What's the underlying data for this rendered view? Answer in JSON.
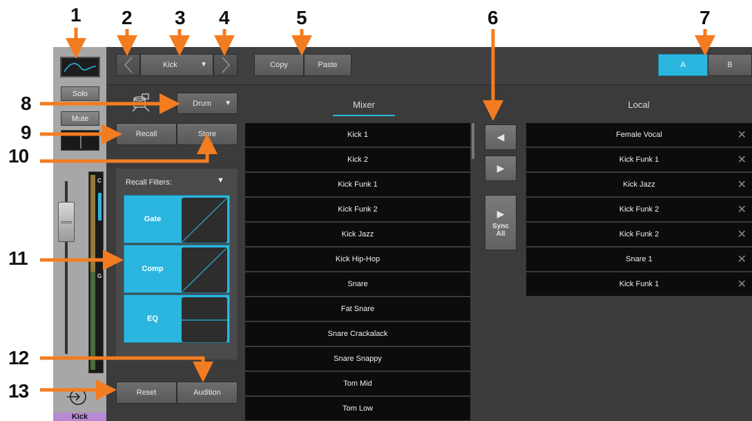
{
  "callouts": [
    "1",
    "2",
    "3",
    "4",
    "5",
    "6",
    "7",
    "8",
    "9",
    "10",
    "11",
    "12",
    "13"
  ],
  "strip": {
    "solo": "Solo",
    "mute": "Mute",
    "meter_labels": [
      "C",
      "G"
    ],
    "channel_name": "Kick",
    "accent": "#b88ad6"
  },
  "toolbar": {
    "preset": "Kick",
    "copy": "Copy",
    "paste": "Paste",
    "tab_a": "A",
    "tab_b": "B",
    "accent": "#2bb6df"
  },
  "library": {
    "category": "Drum",
    "recall": "Recall",
    "store": "Store",
    "filters_title": "Recall Filters:",
    "filters": [
      "Gate",
      "Comp",
      "EQ"
    ],
    "reset": "Reset",
    "audition": "Audition"
  },
  "mixer": {
    "title": "Mixer",
    "items": [
      "Kick 1",
      "Kick 2",
      "Kick Funk 1",
      "Kick Funk 2",
      "Kick Jazz",
      "Kick Hip-Hop",
      "Snare",
      "Fat Snare",
      "Snare Crackalack",
      "Snare Snappy",
      "Tom Mid",
      "Tom Low"
    ]
  },
  "transfer": {
    "sync_line1": "Sync",
    "sync_line2": "All"
  },
  "local": {
    "title": "Local",
    "items": [
      "Female Vocal",
      "Kick Funk 1",
      "Kick Jazz",
      "Kick Funk 2",
      "Kick Funk 2",
      "Snare 1",
      "Kick Funk 1"
    ]
  }
}
